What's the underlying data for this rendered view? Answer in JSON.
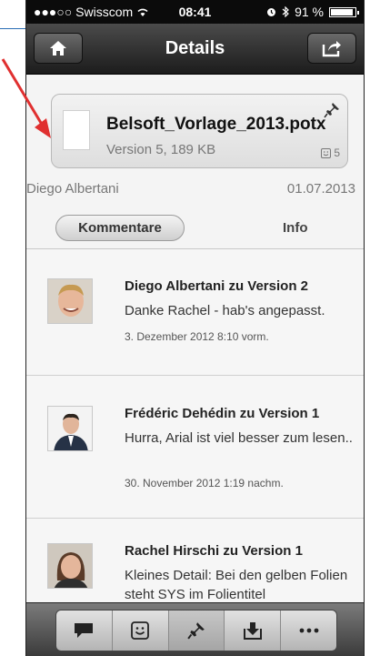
{
  "status": {
    "carrier": "●●●○○ Swisscom",
    "time": "08:41",
    "battery": "91 %",
    "battery_level": 0.91
  },
  "nav": {
    "title": "Details",
    "left_icon": "home-icon",
    "right_icon": "share-icon"
  },
  "file": {
    "name": "Belsoft_Vorlage_2013.potx",
    "meta": "Version 5, 189 KB",
    "comments_count": "5",
    "owner": "Diego Albertani",
    "date": "01.07.2013"
  },
  "tabs": {
    "comments": "Kommentare",
    "info": "Info"
  },
  "comments": [
    {
      "title": "Diego Albertani zu Version 2",
      "text": "Danke Rachel - hab's angepasst.",
      "time": "3. Dezember 2012 8:10 vorm."
    },
    {
      "title": "Frédéric Dehédin zu Version 1",
      "text": "Hurra, Arial ist viel besser zum lesen..",
      "time": "30. November 2012 1:19 nachm."
    },
    {
      "title": "Rachel Hirschi zu Version 1",
      "text": "Kleines Detail: Bei den gelben Folien steht SYS im Folientitel",
      "time": ""
    }
  ],
  "toolbar": {
    "icons": [
      "comment-icon",
      "smiley-icon",
      "pin-icon",
      "download-icon",
      "more-icon"
    ]
  },
  "colors": {
    "annotation_arrow": "#e03030",
    "annotation_line": "#2a6db5"
  }
}
